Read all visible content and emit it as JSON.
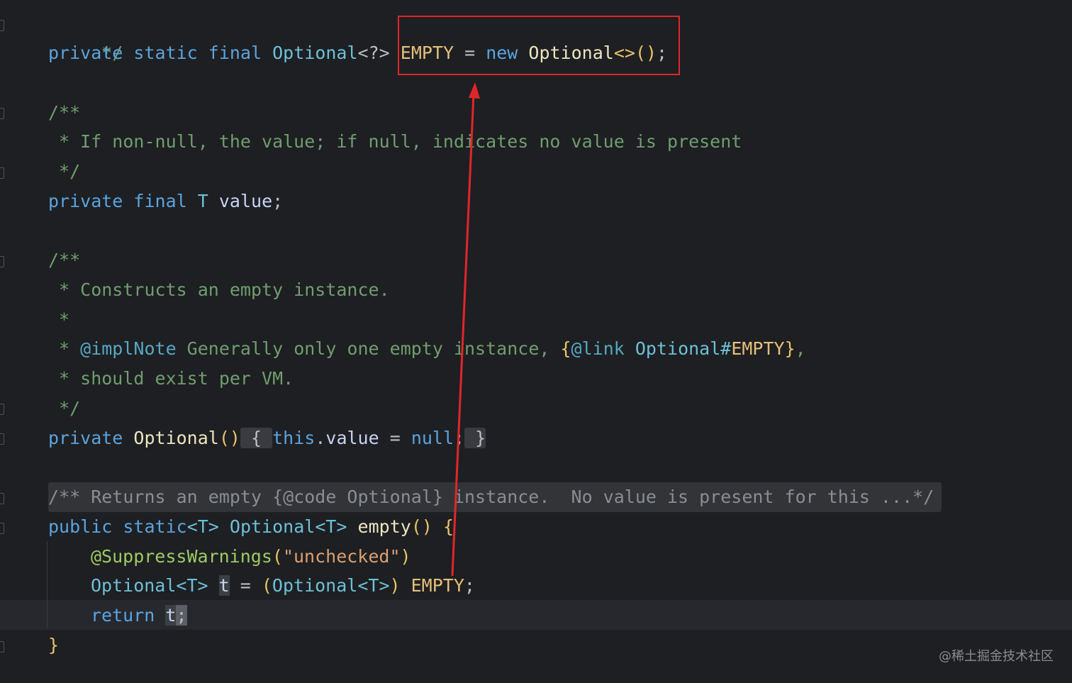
{
  "code": {
    "l0": {
      "comment_close": " */"
    },
    "l1": {
      "private": "private",
      "static": "static",
      "final": "final",
      "type": "Optional",
      "generic": "<?>",
      "name": "EMPTY",
      "eq": " = ",
      "new": "new",
      "ctor": "Optional",
      "diamond": "<>",
      "parens": "()",
      "semi": ";"
    },
    "l3": {
      "text": "/**"
    },
    "l4": {
      "text": " * If non-null, the value; if null, indicates no value is present"
    },
    "l5": {
      "text": " */"
    },
    "l6": {
      "private": "private",
      "final": "final",
      "T": "T",
      "value": "value",
      "semi": ";"
    },
    "l8": {
      "text": "/**"
    },
    "l9": {
      "text": " * Constructs an empty instance."
    },
    "l10": {
      "text": " *"
    },
    "l11": {
      "star": " * ",
      "tag": "@implNote",
      "text": " Generally only one empty instance, ",
      "link_open": "{",
      "link_tag": "@link",
      "link_ref": " Optional#",
      "link_field": "EMPTY",
      "link_close": "}",
      "tail": ","
    },
    "l12": {
      "text": " * should exist per VM."
    },
    "l13": {
      "text": " */"
    },
    "l14": {
      "private": "private",
      "ctor": "Optional",
      "parens": "()",
      "open": " { ",
      "this": "this",
      "dot": ".",
      "value": "value",
      "eq": " = ",
      "null": "null",
      "semi": ";",
      "close": " }"
    },
    "l16": {
      "text": "/** Returns an empty {@code Optional} instance.  No value is present for this ...*/"
    },
    "l17": {
      "public": "public",
      "static": "static",
      "generic": "<T>",
      "type": "Optional",
      "type_generic": "<T>",
      "method": "empty",
      "parens": "()",
      "open": " {"
    },
    "l18": {
      "ann": "@SuppressWarnings",
      "paren_open": "(",
      "str": "\"unchecked\"",
      "paren_close": ")"
    },
    "l19": {
      "type": "Optional",
      "generic": "<T>",
      "var": "t",
      "eq": " = ",
      "cast_open": "(",
      "cast_type": "Optional",
      "cast_generic": "<T>",
      "cast_close": ")",
      "name": "EMPTY",
      "semi": ";"
    },
    "l20": {
      "return": "return",
      "var": "t",
      "semi": ";"
    },
    "l21": {
      "close": "}"
    }
  },
  "annotation": {
    "box_color": "#e0262b",
    "arrow_color": "#e0262b"
  },
  "watermark": "@稀土掘金技术社区"
}
